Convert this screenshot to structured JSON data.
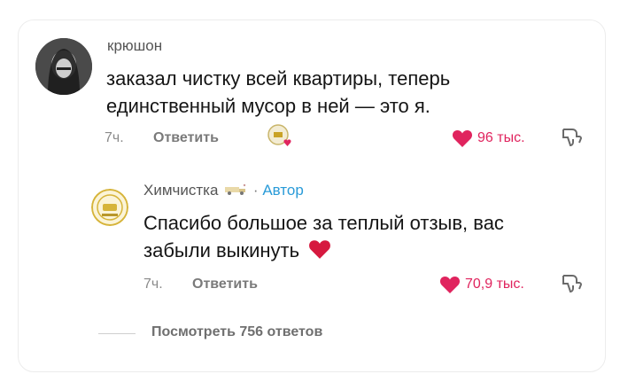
{
  "comment": {
    "username": "крюшон",
    "text_line1": "заказал чистку всей квартиры, теперь",
    "text_line2": "единственный мусор в ней — это я.",
    "time": "7ч.",
    "reply_label": "Ответить",
    "likes": "96 тыс."
  },
  "reply": {
    "username": "Химчистка",
    "separator": "·",
    "author_badge": "Автор",
    "text_line1": "Спасибо большое за теплый отзыв, вас",
    "text_line2": "забыли выкинуть",
    "time": "7ч.",
    "reply_label": "Ответить",
    "likes": "70,9 тыс."
  },
  "view_replies_label": "Посмотреть 756 ответов",
  "colors": {
    "like_red": "#e0245e",
    "author_blue": "#2a9bd8"
  }
}
